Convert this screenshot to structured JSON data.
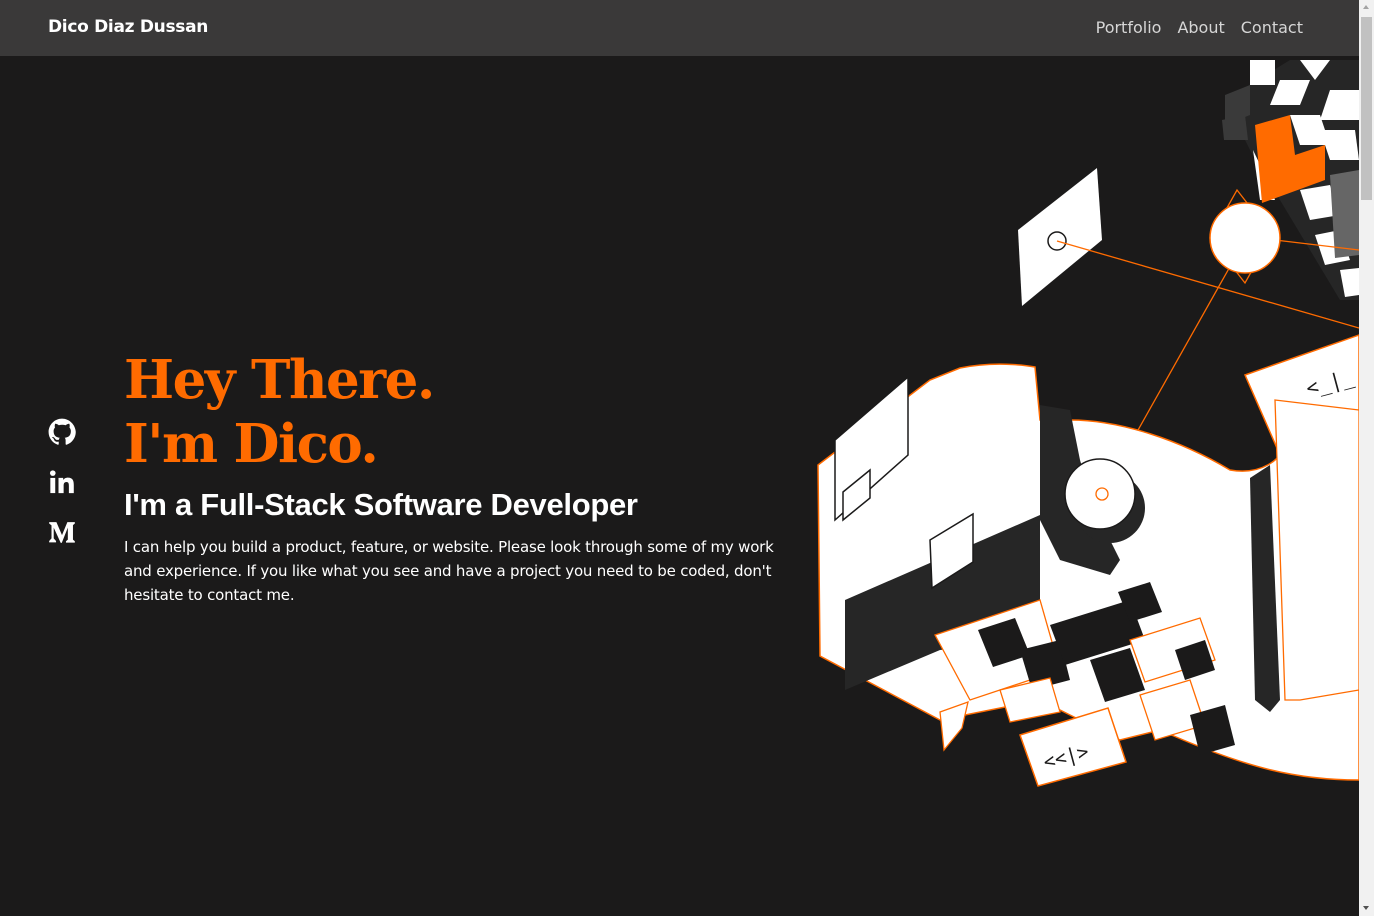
{
  "navbar": {
    "brand": "Dico Diaz Dussan",
    "links": [
      {
        "label": "Portfolio"
      },
      {
        "label": "About"
      },
      {
        "label": "Contact"
      }
    ]
  },
  "socials": [
    {
      "icon": "github-icon"
    },
    {
      "icon": "linkedin-icon"
    },
    {
      "icon": "medium-icon"
    }
  ],
  "hero": {
    "title_line1": "Hey There.",
    "title_line2": "I'm Dico.",
    "subtitle": "I'm a Full-Stack Software Developer",
    "text": "I can help you build a product, feature, or website. Please look through some of my work and experience. If you like what you see and have a project you need to be coded, don't hesitate to contact me."
  },
  "illustration": {
    "code_tag_1": "<_|_",
    "code_tag_2": "<<|>"
  },
  "colors": {
    "accent": "#ff6b00",
    "background": "#1b1a1a",
    "navbar": "#3a3939"
  }
}
